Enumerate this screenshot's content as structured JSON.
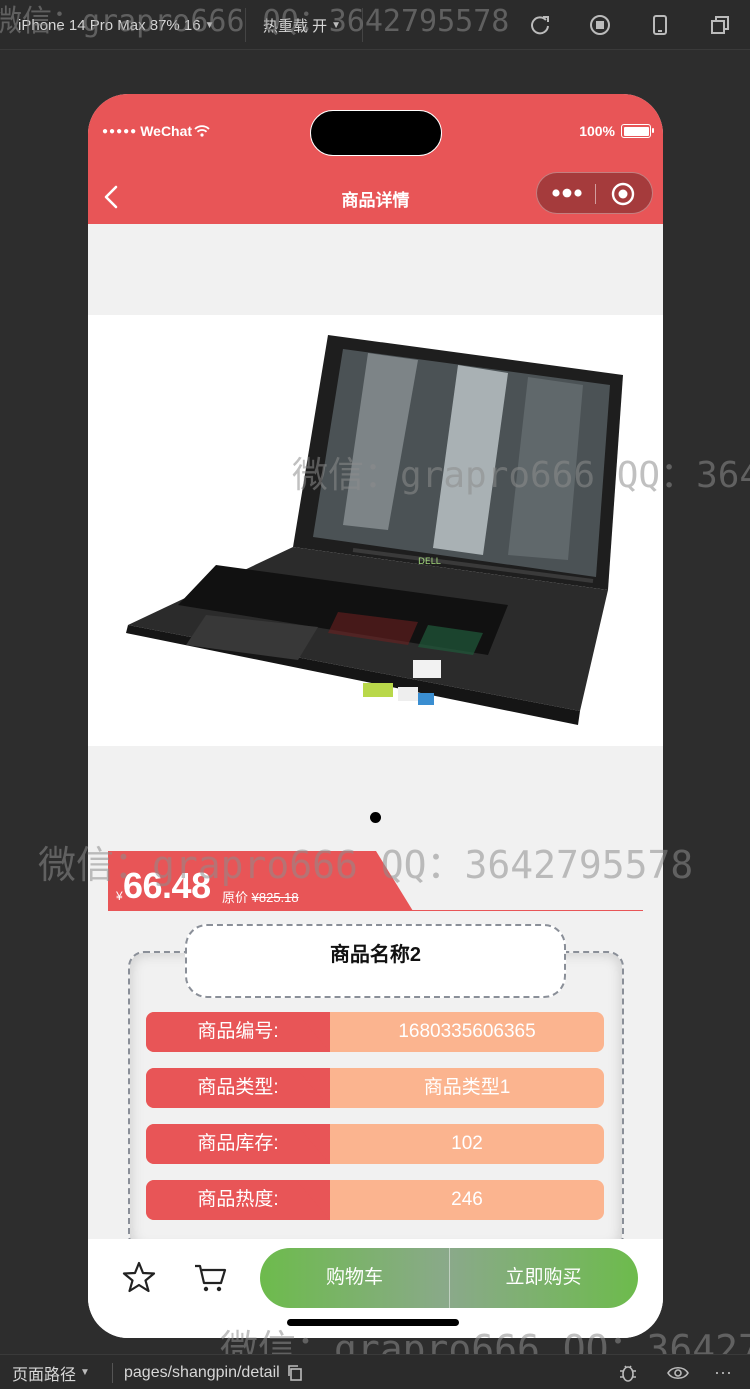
{
  "devtools": {
    "device_label": "iPhone 14 Pro Max 87% 16",
    "hot_reload_label": "热重载 开",
    "path_label": "页面路径",
    "path_value": "pages/shangpin/detail"
  },
  "watermark": "微信：grapro666 QQ：3642795578",
  "status_bar": {
    "carrier": "WeChat",
    "battery": "100%"
  },
  "nav": {
    "title": "商品详情"
  },
  "product": {
    "currency_symbol": "¥",
    "price": "66.48",
    "original_price_label": "原价",
    "original_price": "¥825.18",
    "name": "商品名称2",
    "details": [
      {
        "label": "商品编号:",
        "value": "1680335606365"
      },
      {
        "label": "商品类型:",
        "value": "商品类型1"
      },
      {
        "label": "商品库存:",
        "value": "102"
      },
      {
        "label": "商品热度:",
        "value": "246"
      }
    ]
  },
  "actions": {
    "cart_button": "购物车",
    "buy_button": "立即购买"
  },
  "colors": {
    "primary": "#e85557",
    "value_bg": "#fbb48f",
    "action_green": "#6dbb4c"
  },
  "icons": [
    "star-icon",
    "cart-icon",
    "back-icon",
    "more-icon",
    "target-icon"
  ]
}
